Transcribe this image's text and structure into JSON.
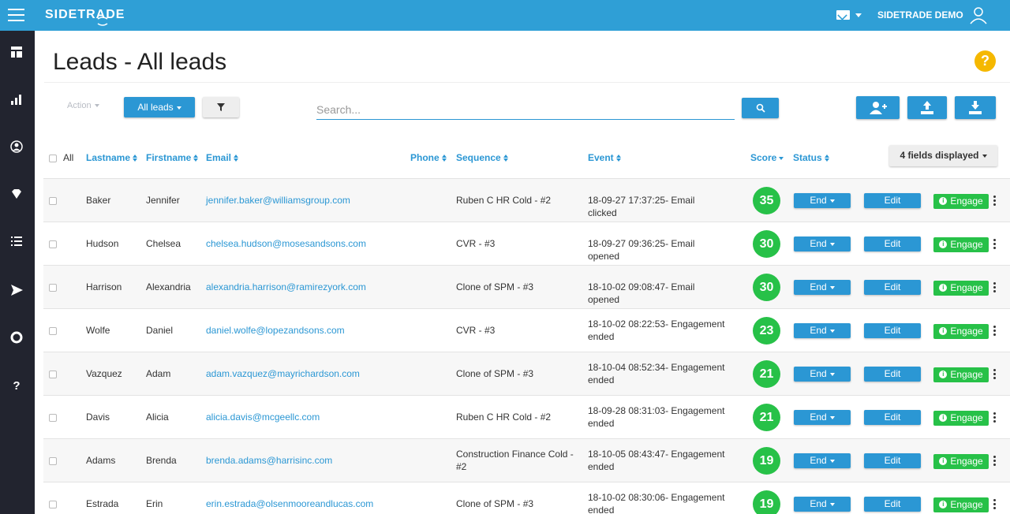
{
  "app": {
    "brand": "SIDETRADE",
    "user_name": "SIDETRADE DEMO"
  },
  "header": {
    "title": "Leads - All leads",
    "help": "?"
  },
  "toolbar": {
    "action_label": "Action",
    "view_label": "All leads",
    "search_placeholder": "Search..."
  },
  "sidebar": {
    "items": [
      {
        "name": "dashboard-icon",
        "glyph": "▦"
      },
      {
        "name": "bar-chart-icon",
        "glyph": "▁▃▅"
      },
      {
        "name": "user-circle-icon",
        "glyph": "◉"
      },
      {
        "name": "diamond-icon",
        "glyph": "◆"
      },
      {
        "name": "list-icon",
        "glyph": "☰"
      },
      {
        "name": "send-icon",
        "glyph": "➤"
      },
      {
        "name": "lifebuoy-icon",
        "glyph": "○"
      },
      {
        "name": "help-icon",
        "glyph": "?"
      }
    ]
  },
  "table": {
    "columns": {
      "all": "All",
      "lastname": "Lastname",
      "firstname": "Firstname",
      "email": "Email",
      "phone": "Phone",
      "sequence": "Sequence",
      "event": "Event",
      "score": "Score",
      "status": "Status",
      "fields_displayed": "4 fields displayed"
    },
    "rows": [
      {
        "lastname": "Baker",
        "firstname": "Jennifer",
        "email": "jennifer.baker@williamsgroup.com",
        "sequence": "Ruben C HR Cold - #2",
        "event": "18-09-27 17:37:25- Email clicked",
        "score": "35",
        "status": "End",
        "edit": "Edit",
        "engage": "Engage"
      },
      {
        "lastname": "Hudson",
        "firstname": "Chelsea",
        "email": "chelsea.hudson@mosesandsons.com",
        "sequence": "CVR - #3",
        "event": "18-09-27 09:36:25- Email opened",
        "score": "30",
        "status": "End",
        "edit": "Edit",
        "engage": "Engage"
      },
      {
        "lastname": "Harrison",
        "firstname": "Alexandria",
        "email": "alexandria.harrison@ramirezyork.com",
        "sequence": "Clone of SPM - #3",
        "event": "18-10-02 09:08:47- Email opened",
        "score": "30",
        "status": "End",
        "edit": "Edit",
        "engage": "Engage"
      },
      {
        "lastname": "Wolfe",
        "firstname": "Daniel",
        "email": "daniel.wolfe@lopezandsons.com",
        "sequence": "CVR - #3",
        "event": "18-10-02 08:22:53- Engagement ended",
        "score": "23",
        "status": "End",
        "edit": "Edit",
        "engage": "Engage"
      },
      {
        "lastname": "Vazquez",
        "firstname": "Adam",
        "email": "adam.vazquez@mayrichardson.com",
        "sequence": "Clone of SPM - #3",
        "event": "18-10-04 08:52:34- Engagement ended",
        "score": "21",
        "status": "End",
        "edit": "Edit",
        "engage": "Engage"
      },
      {
        "lastname": "Davis",
        "firstname": "Alicia",
        "email": "alicia.davis@mcgeellc.com",
        "sequence": "Ruben C HR Cold - #2",
        "event": "18-09-28 08:31:03- Engagement ended",
        "score": "21",
        "status": "End",
        "edit": "Edit",
        "engage": "Engage"
      },
      {
        "lastname": "Adams",
        "firstname": "Brenda",
        "email": "brenda.adams@harrisinc.com",
        "sequence": "Construction Finance Cold - #2",
        "event": "18-10-05 08:43:47- Engagement ended",
        "score": "19",
        "status": "End",
        "edit": "Edit",
        "engage": "Engage"
      },
      {
        "lastname": "Estrada",
        "firstname": "Erin",
        "email": "erin.estrada@olsenmooreandlucas.com",
        "sequence": "Clone of SPM - #3",
        "event": "18-10-02 08:30:06- Engagement ended",
        "score": "19",
        "status": "End",
        "edit": "Edit",
        "engage": "Engage"
      }
    ]
  },
  "colors": {
    "brand": "#2f9fd6",
    "button": "#2b97d4",
    "score": "#27c148",
    "sidebar": "#22242f",
    "help": "#f5b800"
  }
}
